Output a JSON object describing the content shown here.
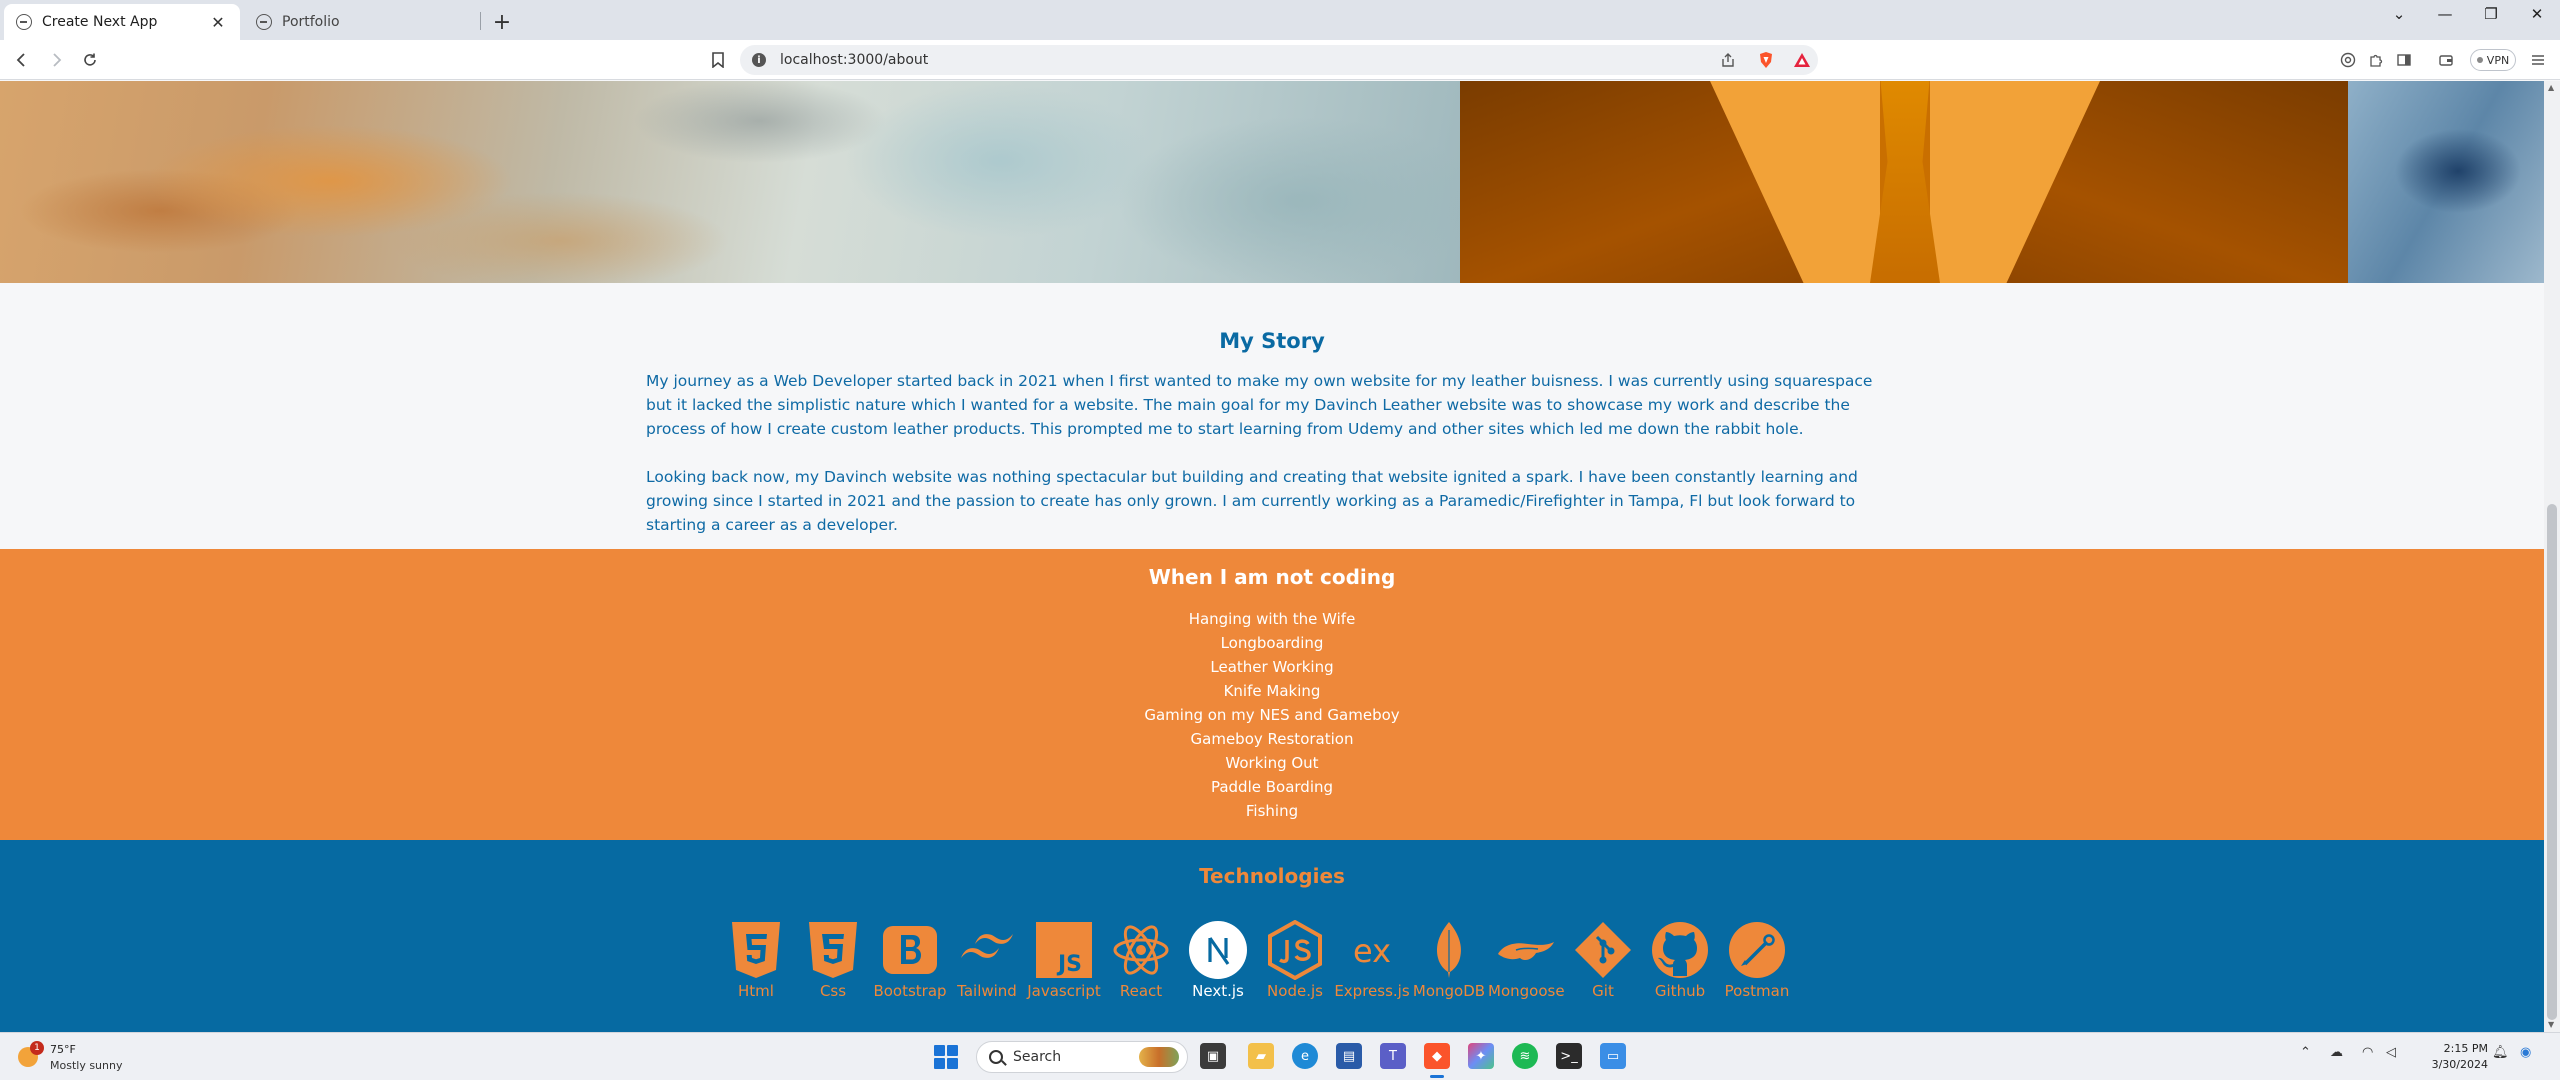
{
  "browser": {
    "tabs": [
      {
        "title": "Create Next App",
        "active": true
      },
      {
        "title": "Portfolio",
        "active": false
      }
    ],
    "new_tab_label": "+",
    "url": "localhost:3000/about",
    "vpn_label": "VPN",
    "window_controls": {
      "dropdown": "⌄",
      "minimize": "—",
      "restore": "❐",
      "close": "✕"
    }
  },
  "page": {
    "story": {
      "heading": "My Story",
      "paragraph_1": "My journey as a Web Developer started back in 2021 when I first wanted to make my own website for my leather buisness. I was currently using squarespace but it lacked the simplistic nature which I wanted for a website. The main goal for my Davinch Leather website was to showcase my work and describe the process of how I create custom leather products. This prompted me to start learning from Udemy and other sites which led me down the rabbit hole.",
      "paragraph_2": "Looking back now, my Davinch website was nothing spectacular but building and creating that website ignited a spark. I have been constantly learning and growing since I started in 2021 and the passion to create has only grown. I am currently working as a Paramedic/Firefighter in Tampa, Fl but look forward to starting a career as a developer."
    },
    "hobbies": {
      "heading": "When I am not coding",
      "items": [
        "Hanging with the Wife",
        "Longboarding",
        "Leather Working",
        "Knife Making",
        "Gaming on my NES and Gameboy",
        "Gameboy Restoration",
        "Working Out",
        "Paddle Boarding",
        "Fishing"
      ]
    },
    "technologies": {
      "heading": "Technologies",
      "items": [
        {
          "label": "Html",
          "icon": "html5-icon"
        },
        {
          "label": "Css",
          "icon": "css3-icon"
        },
        {
          "label": "Bootstrap",
          "icon": "bootstrap-icon"
        },
        {
          "label": "Tailwind",
          "icon": "tailwind-icon"
        },
        {
          "label": "Javascript",
          "icon": "javascript-icon"
        },
        {
          "label": "React",
          "icon": "react-icon"
        },
        {
          "label": "Next.js",
          "icon": "nextjs-icon",
          "highlighted": true
        },
        {
          "label": "Node.js",
          "icon": "nodejs-icon"
        },
        {
          "label": "Express.js",
          "icon": "express-icon"
        },
        {
          "label": "MongoDB",
          "icon": "mongodb-icon"
        },
        {
          "label": "Mongoose",
          "icon": "mongoose-icon"
        },
        {
          "label": "Git",
          "icon": "git-icon"
        },
        {
          "label": "Github",
          "icon": "github-icon"
        },
        {
          "label": "Postman",
          "icon": "postman-icon"
        }
      ]
    }
  },
  "taskbar": {
    "weather": {
      "temp": "75°F",
      "condition": "Mostly sunny",
      "badge": "1"
    },
    "search_placeholder": "Search",
    "time": "2:15 PM",
    "date": "3/30/2024"
  },
  "colors": {
    "accent_orange": "#ee883a",
    "primary_blue": "#066aa2",
    "story_text": "#0f6aa5"
  }
}
